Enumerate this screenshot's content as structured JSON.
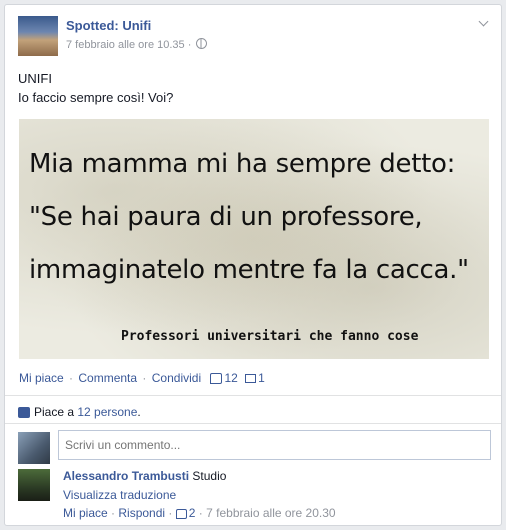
{
  "post": {
    "page_name": "Spotted: Unifi",
    "timestamp": "7 febbraio alle ore 10.35",
    "timestamp_sep": "·",
    "text_line1": "UNIFI",
    "text_line2": "Io faccio sempre così! Voi?"
  },
  "image": {
    "line1": "Mia mamma mi ha sempre detto:",
    "line2": "\"Se hai paura di un professore,",
    "line3": "immaginatelo mentre fa la cacca.\"",
    "caption": "Professori universitari che fanno cose"
  },
  "actions": {
    "like": "Mi piace",
    "comment": "Commenta",
    "share": "Condividi",
    "sep": "·",
    "like_count": "12",
    "comment_count": "1"
  },
  "likes_summary": {
    "prefix": "Piace a ",
    "link": "12 persone",
    "suffix": "."
  },
  "comment_box": {
    "placeholder": "Scrivi un commento..."
  },
  "comment": {
    "author": "Alessandro Trambusti",
    "text": " Studio",
    "translate": "Visualizza traduzione",
    "like": "Mi piace",
    "reply": "Rispondi",
    "sep": "·",
    "like_count": "2",
    "timestamp": "7 febbraio alle ore 20.30"
  },
  "colors": {
    "link": "#3b5998",
    "meta": "#90949c",
    "text": "#141823"
  },
  "icons": [
    "globe-icon",
    "chevron-down-icon",
    "like-icon",
    "comment-icon",
    "thumb-icon"
  ]
}
